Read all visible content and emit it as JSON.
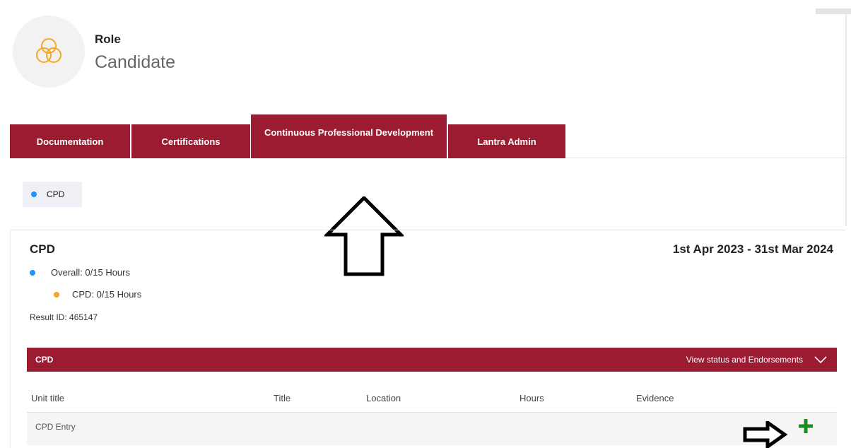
{
  "role": {
    "label": "Role",
    "value": "Candidate",
    "icon": "venn-circles-icon",
    "icon_color": "#f5a623"
  },
  "tabs": [
    {
      "label": "Documentation"
    },
    {
      "label": "Certifications"
    },
    {
      "label": "Continuous Professional Development",
      "active": true
    },
    {
      "label": "Lantra Admin"
    }
  ],
  "filter_pill": {
    "label": "CPD",
    "dot_color": "#1e90ff"
  },
  "summary": {
    "heading": "CPD",
    "date_range": "1st Apr 2023 - 31st Mar 2024",
    "overall": "Overall: 0/15 Hours",
    "cpd_hours": "CPD: 0/15 Hours",
    "result_id": "Result ID: 465147"
  },
  "section": {
    "title": "CPD",
    "view_status": "View status and Endorsements",
    "icon": "chevron-down-icon"
  },
  "table": {
    "columns": [
      "Unit title",
      "Title",
      "Location",
      "Hours",
      "Evidence"
    ],
    "rows": [
      {
        "unit_title": "CPD Entry",
        "action_icon": "plus-icon"
      }
    ]
  },
  "colors": {
    "brand": "#9b1b30",
    "blue_dot": "#1e90ff",
    "orange_dot": "#f5a623",
    "add_green": "#1e8c1e"
  }
}
